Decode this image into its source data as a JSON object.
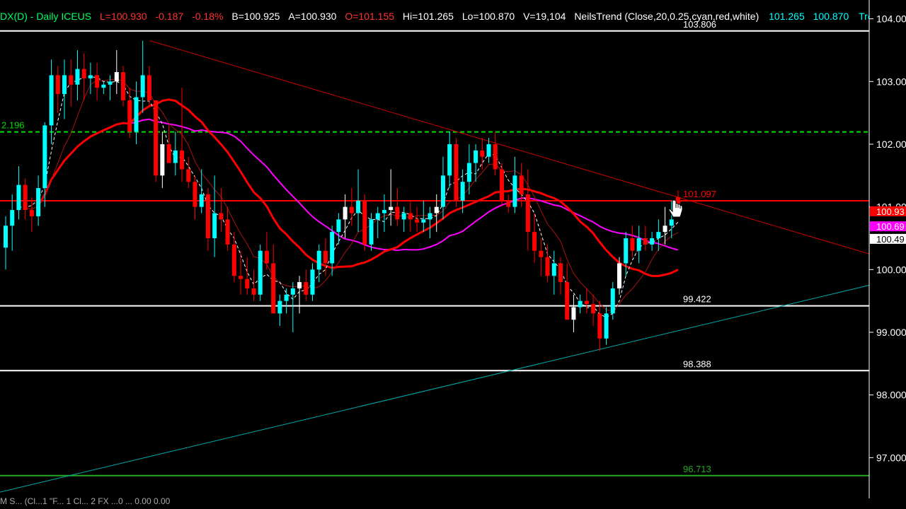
{
  "header": {
    "symbol": "DX(D) - Daily  ICEUS",
    "last": "L=100.930",
    "change": "-0.187",
    "change_pct": "-0.18%",
    "bid": "B=100.925",
    "ask": "A=100.930",
    "open": "O=101.155",
    "high": "Hi=101.265",
    "low": "Lo=100.870",
    "volume": "V=19,104",
    "indicator": "NeilsTrend (Close,20,0.25,cyan,red,white)",
    "ind_hi": "101.265",
    "ind_lo": "100.870",
    "trend": "Tren ..."
  },
  "footer": {
    "text": "M S... (Cl...1 \"F... 1 Cl... 2 FX ...0 ...  0.00  0.00"
  },
  "colors": {
    "up_candle": "#00ffff",
    "down_candle": "#ff0000",
    "neutral_candle": "#ffffff",
    "magenta_ma": "#ff00ff",
    "red_ma": "#ff0000",
    "support_line": "#ffffff",
    "green_line": "#22aa22",
    "green_dashed": "#00dd00",
    "trendline_up": "#00aaaa",
    "trendline_down": "#cc0000"
  },
  "chart_data": {
    "type": "candlestick",
    "ylim": [
      96.35,
      104.3
    ],
    "y_ticks": [
      "104.000",
      "103.000",
      "102.000",
      "101.000",
      "100.000",
      "99.000",
      "98.000",
      "97.000"
    ],
    "levels": [
      {
        "value": 103.806,
        "label": "103.806",
        "color": "#ffffff",
        "style": "solid"
      },
      {
        "value": 102.196,
        "label": "2.196",
        "color": "#00dd00",
        "style": "dashed"
      },
      {
        "value": 101.097,
        "label": "101.097",
        "color": "#ff0000",
        "style": "solid"
      },
      {
        "value": 99.422,
        "label": "99.422",
        "color": "#ffffff",
        "style": "solid"
      },
      {
        "value": 98.388,
        "label": "98.388",
        "color": "#ffffff",
        "style": "solid"
      },
      {
        "value": 96.713,
        "label": "96.713",
        "color": "#22aa22",
        "style": "solid"
      }
    ],
    "price_tags": [
      {
        "value": 100.93,
        "label": "100.93",
        "bg": "#ff0000",
        "fg": "#ffffff"
      },
      {
        "value": 100.69,
        "label": "100.69",
        "bg": "#ff00ff",
        "fg": "#ffffff"
      },
      {
        "value": 100.49,
        "label": "100.49",
        "bg": "#ffffff",
        "fg": "#000000"
      }
    ],
    "candles": [
      [
        100.35,
        100.85,
        100.0,
        100.7
      ],
      [
        100.7,
        101.2,
        100.3,
        100.95
      ],
      [
        100.95,
        101.65,
        100.8,
        101.35
      ],
      [
        101.35,
        101.45,
        100.8,
        100.95
      ],
      [
        100.95,
        101.15,
        100.6,
        100.85
      ],
      [
        100.85,
        101.5,
        100.7,
        101.3
      ],
      [
        101.3,
        102.35,
        101.0,
        102.3
      ],
      [
        102.3,
        103.35,
        102.0,
        103.1
      ],
      [
        103.1,
        103.25,
        102.5,
        102.8
      ],
      [
        102.8,
        103.35,
        102.4,
        103.1
      ],
      [
        103.1,
        103.35,
        102.6,
        102.95
      ],
      [
        102.95,
        103.5,
        102.7,
        103.2
      ],
      [
        103.2,
        103.45,
        102.7,
        103.05
      ],
      [
        103.05,
        103.3,
        102.8,
        103.1
      ],
      [
        103.1,
        103.3,
        102.7,
        102.9
      ],
      [
        102.9,
        103.0,
        102.8,
        102.95
      ],
      [
        102.95,
        103.1,
        102.7,
        103.0
      ],
      [
        103.0,
        103.5,
        102.8,
        103.15
      ],
      [
        103.15,
        103.25,
        102.6,
        102.7
      ],
      [
        102.7,
        102.9,
        102.1,
        102.2
      ],
      [
        102.2,
        103.0,
        102.0,
        102.75
      ],
      [
        102.75,
        103.65,
        102.5,
        103.1
      ],
      [
        103.1,
        103.25,
        102.6,
        102.7
      ],
      [
        102.7,
        102.6,
        101.4,
        101.5
      ],
      [
        101.5,
        102.2,
        101.3,
        102.0
      ],
      [
        102.0,
        102.3,
        101.8,
        101.7
      ],
      [
        101.7,
        102.2,
        101.5,
        101.9
      ],
      [
        101.9,
        102.9,
        101.4,
        101.6
      ],
      [
        101.6,
        101.8,
        101.3,
        101.4
      ],
      [
        101.4,
        101.5,
        100.8,
        101.0
      ],
      [
        101.0,
        101.6,
        100.9,
        101.2
      ],
      [
        101.2,
        101.3,
        100.3,
        100.5
      ],
      [
        100.5,
        101.5,
        100.2,
        100.9
      ],
      [
        100.9,
        101.3,
        100.6,
        100.8
      ],
      [
        100.8,
        101.0,
        100.3,
        100.4
      ],
      [
        100.4,
        100.6,
        99.8,
        99.9
      ],
      [
        99.9,
        100.3,
        99.6,
        99.85
      ],
      [
        99.85,
        100.2,
        99.6,
        99.7
      ],
      [
        99.7,
        100.0,
        99.5,
        99.6
      ],
      [
        99.6,
        100.4,
        99.5,
        100.3
      ],
      [
        100.3,
        100.6,
        100.0,
        100.1
      ],
      [
        100.1,
        100.4,
        99.5,
        99.3
      ],
      [
        99.3,
        99.6,
        99.1,
        99.5
      ],
      [
        99.5,
        99.7,
        99.3,
        99.6
      ],
      [
        99.6,
        99.8,
        99.0,
        99.7
      ],
      [
        99.7,
        99.9,
        99.3,
        99.8
      ],
      [
        99.8,
        100.0,
        99.5,
        99.6
      ],
      [
        99.6,
        100.1,
        99.5,
        100.0
      ],
      [
        100.0,
        100.4,
        99.8,
        100.3
      ],
      [
        100.3,
        100.5,
        99.9,
        100.1
      ],
      [
        100.1,
        100.7,
        99.9,
        100.6
      ],
      [
        100.6,
        100.9,
        100.4,
        100.8
      ],
      [
        100.8,
        101.2,
        100.5,
        101.0
      ],
      [
        101.0,
        101.3,
        100.7,
        100.9
      ],
      [
        100.9,
        101.6,
        100.6,
        101.1
      ],
      [
        101.1,
        101.2,
        100.3,
        100.4
      ],
      [
        100.4,
        100.9,
        100.3,
        100.8
      ],
      [
        100.8,
        101.0,
        100.5,
        100.9
      ],
      [
        100.9,
        101.2,
        100.6,
        100.95
      ],
      [
        100.95,
        101.6,
        100.7,
        101.0
      ],
      [
        101.0,
        101.3,
        100.7,
        100.8
      ],
      [
        100.8,
        101.0,
        100.6,
        100.9
      ],
      [
        100.9,
        101.1,
        100.6,
        100.8
      ],
      [
        100.8,
        101.0,
        100.6,
        100.75
      ],
      [
        100.75,
        101.1,
        100.6,
        100.8
      ],
      [
        100.8,
        101.0,
        100.5,
        100.9
      ],
      [
        100.9,
        101.2,
        100.6,
        101.0
      ],
      [
        101.0,
        101.8,
        100.8,
        101.5
      ],
      [
        101.5,
        102.2,
        101.3,
        102.0
      ],
      [
        102.0,
        102.1,
        101.0,
        101.1
      ],
      [
        101.1,
        101.6,
        100.9,
        101.4
      ],
      [
        101.4,
        102.0,
        101.2,
        101.7
      ],
      [
        101.7,
        102.0,
        101.4,
        101.9
      ],
      [
        101.9,
        102.1,
        101.6,
        101.8
      ],
      [
        101.8,
        102.1,
        101.7,
        102.0
      ],
      [
        102.0,
        102.2,
        101.5,
        101.6
      ],
      [
        101.6,
        101.7,
        101.0,
        101.1
      ],
      [
        101.1,
        101.2,
        100.9,
        101.0
      ],
      [
        101.0,
        101.8,
        100.9,
        101.5
      ],
      [
        101.5,
        101.7,
        101.0,
        101.2
      ],
      [
        101.2,
        101.6,
        100.3,
        100.6
      ],
      [
        100.6,
        100.9,
        100.1,
        100.3
      ],
      [
        100.3,
        100.5,
        99.9,
        100.2
      ],
      [
        100.2,
        100.4,
        99.8,
        99.9
      ],
      [
        99.9,
        100.3,
        99.6,
        100.1
      ],
      [
        100.1,
        100.2,
        99.6,
        99.8
      ],
      [
        99.8,
        100.1,
        99.4,
        99.2
      ],
      [
        99.2,
        99.6,
        99.0,
        99.4
      ],
      [
        99.4,
        99.6,
        99.3,
        99.5
      ],
      [
        99.5,
        99.7,
        99.3,
        99.45
      ],
      [
        99.45,
        99.6,
        99.1,
        99.3
      ],
      [
        99.3,
        99.5,
        98.7,
        98.9
      ],
      [
        98.9,
        99.4,
        98.8,
        99.3
      ],
      [
        99.3,
        99.8,
        99.2,
        99.7
      ],
      [
        99.7,
        100.2,
        99.6,
        100.1
      ],
      [
        100.1,
        100.6,
        99.9,
        100.5
      ],
      [
        100.5,
        100.7,
        100.2,
        100.3
      ],
      [
        100.3,
        100.7,
        100.1,
        100.5
      ],
      [
        100.5,
        100.7,
        100.3,
        100.4
      ],
      [
        100.4,
        100.6,
        100.3,
        100.5
      ],
      [
        100.5,
        100.8,
        100.3,
        100.6
      ],
      [
        100.6,
        101.0,
        100.4,
        100.7
      ],
      [
        100.7,
        101.1,
        100.5,
        100.8
      ],
      [
        101.155,
        101.265,
        100.87,
        100.93
      ]
    ]
  }
}
